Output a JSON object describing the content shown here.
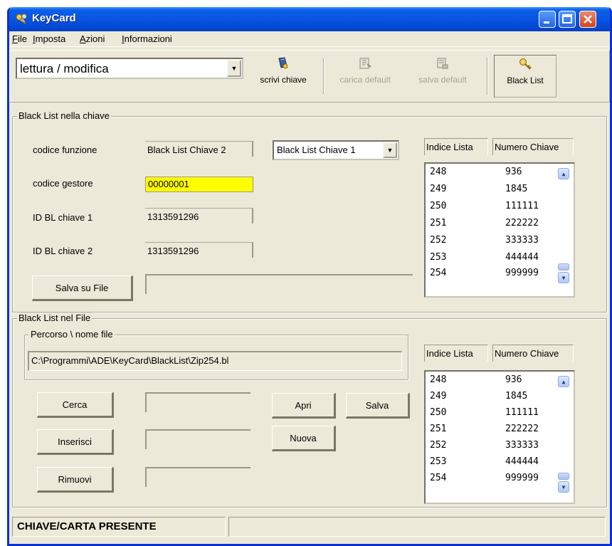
{
  "window": {
    "title": "KeyCard"
  },
  "menu": [
    {
      "label_u": "F",
      "label_rest": "ile"
    },
    {
      "label_u": "I",
      "label_rest": "mposta"
    },
    {
      "label_u": "A",
      "label_rest": "zioni"
    },
    {
      "label_u": "I",
      "label_rest": "nformazioni"
    }
  ],
  "toolbar": {
    "mode_value": "lettura / modifica",
    "write_key": "scrivi chiave",
    "load_default": "carica default",
    "save_default": "salva default",
    "black_list": "Black List"
  },
  "key_group": {
    "title": "Black List nella chiave",
    "function_code_label": "codice funzione",
    "function_code_value": "Black List Chiave 2",
    "function_select_value": "Black List Chiave 1",
    "manager_code_label": "codice gestore",
    "manager_code_value": "00000001",
    "bl_id1_label": "ID BL chiave 1",
    "bl_id1_value": "1313591296",
    "bl_id2_label": "ID BL chiave 2",
    "bl_id2_value": "1313591296",
    "save_file_button": "Salva su File",
    "list_header_index": "Indice Lista",
    "list_header_number": "Numero Chiave",
    "rows": [
      {
        "index": "248",
        "number": "936"
      },
      {
        "index": "249",
        "number": "1845"
      },
      {
        "index": "250",
        "number": "111111"
      },
      {
        "index": "251",
        "number": "222222"
      },
      {
        "index": "252",
        "number": "333333"
      },
      {
        "index": "253",
        "number": "444444"
      },
      {
        "index": "254",
        "number": "999999"
      }
    ]
  },
  "file_group": {
    "title": "Black List nel File",
    "path_group_title": "Percorso \\ nome file",
    "path_value": "C:\\Programmi\\ADE\\KeyCard\\BlackList\\Zip254.bl",
    "search_button": "Cerca",
    "insert_button": "Inserisci",
    "remove_button": "Rimuovi",
    "open_button": "Apri",
    "save_button": "Salva",
    "new_button": "Nuova",
    "list_header_index": "Indice Lista",
    "list_header_number": "Numero Chiave",
    "rows": [
      {
        "index": "248",
        "number": "936"
      },
      {
        "index": "249",
        "number": "1845"
      },
      {
        "index": "250",
        "number": "111111"
      },
      {
        "index": "251",
        "number": "222222"
      },
      {
        "index": "252",
        "number": "333333"
      },
      {
        "index": "253",
        "number": "444444"
      },
      {
        "index": "254",
        "number": "999999"
      }
    ]
  },
  "status": {
    "text": "CHIAVE/CARTA PRESENTE",
    "text2": ""
  },
  "icons": {
    "app": "keys-icon",
    "write_key": "write-key-icon",
    "load_default": "load-default-icon",
    "save_default": "save-default-icon",
    "black_list": "key-icon"
  },
  "colors": {
    "titlebar": "#0a55e0",
    "highlight_field": "#ffff00",
    "window_bg": "#ece9d8"
  }
}
